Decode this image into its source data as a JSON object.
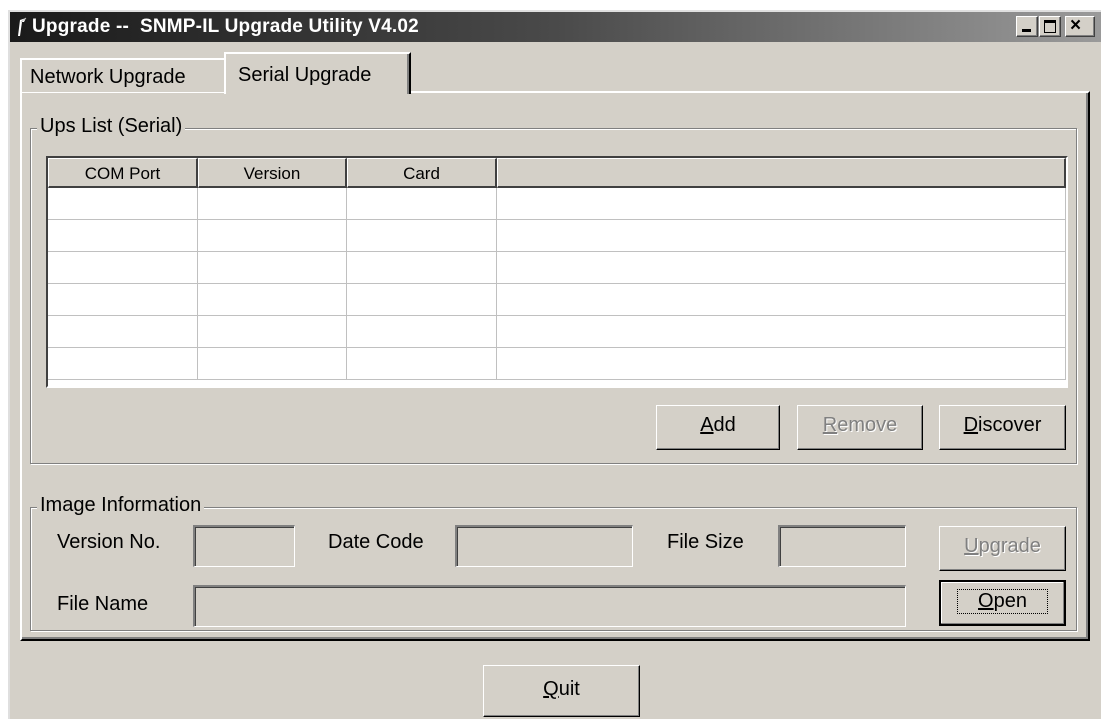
{
  "window": {
    "title_prefix": "Upgrade --",
    "title_main": "SNMP-IL Upgrade Utility V4.02",
    "controls": {
      "minimize": "minimize",
      "maximize": "maximize",
      "close": "×"
    }
  },
  "tabs": [
    {
      "label": "Network Upgrade",
      "selected": false
    },
    {
      "label": "Serial Upgrade",
      "selected": true
    }
  ],
  "ups_list": {
    "group_title": "Ups List (Serial)",
    "columns": [
      "COM Port",
      "Version",
      "Card",
      ""
    ],
    "rows": [
      [
        "",
        "",
        "",
        ""
      ],
      [
        "",
        "",
        "",
        ""
      ],
      [
        "",
        "",
        "",
        ""
      ],
      [
        "",
        "",
        "",
        ""
      ],
      [
        "",
        "",
        "",
        ""
      ],
      [
        "",
        "",
        "",
        ""
      ]
    ],
    "buttons": {
      "add": {
        "mnemonic": "A",
        "rest": "dd",
        "enabled": true
      },
      "remove": {
        "mnemonic": "R",
        "rest": "emove",
        "enabled": false
      },
      "discover": {
        "mnemonic": "D",
        "rest": "iscover",
        "enabled": true
      }
    }
  },
  "image_info": {
    "group_title": "Image Information",
    "version_label": "Version No.",
    "version_value": "",
    "date_label": "Date Code",
    "date_value": "",
    "size_label": "File Size",
    "size_value": "",
    "filename_label": "File Name",
    "filename_value": "",
    "upgrade": {
      "mnemonic": "U",
      "rest": "pgrade",
      "enabled": false
    },
    "open": {
      "mnemonic": "O",
      "rest": "pen",
      "enabled": true,
      "default": true
    }
  },
  "quit": {
    "mnemonic": "Q",
    "rest": "uit"
  }
}
